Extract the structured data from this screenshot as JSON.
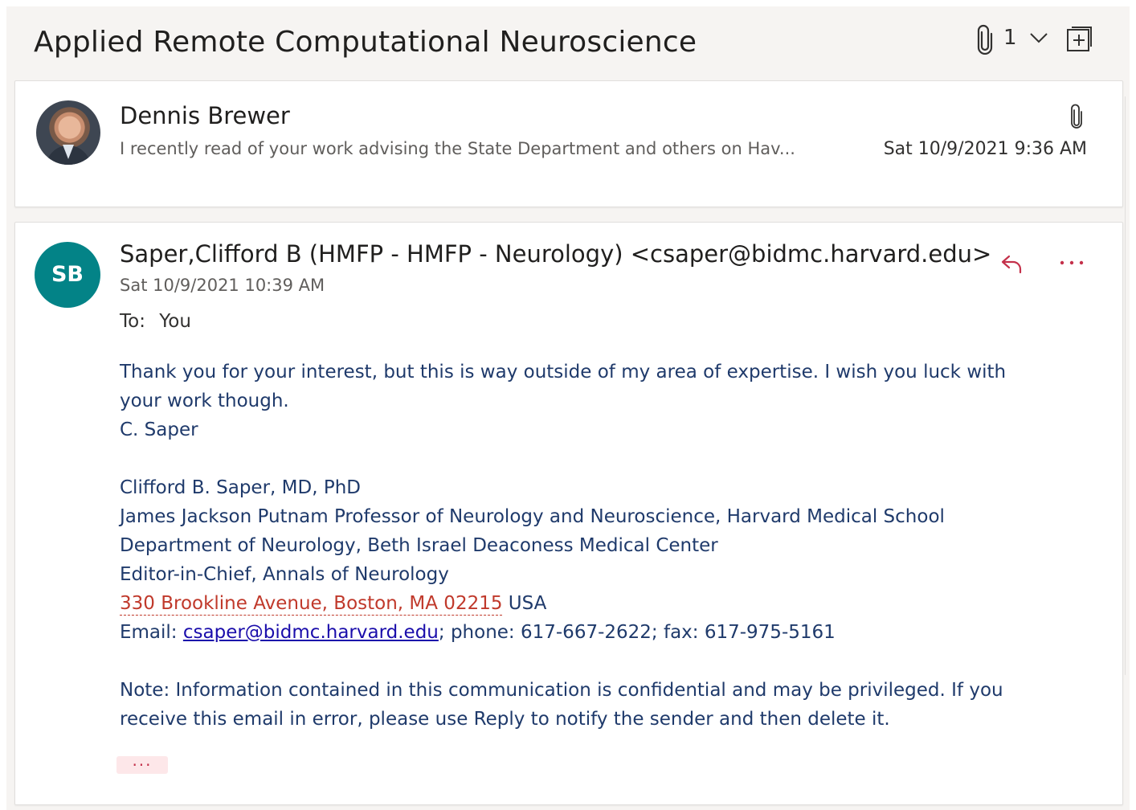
{
  "conversation": {
    "title": "Applied Remote Computational Neuroscience",
    "attachment_count": "1"
  },
  "message1": {
    "sender": "Dennis Brewer",
    "preview": "I recently read of your work advising the State Department and others on Hav...",
    "date": "Sat 10/9/2021 9:36 AM",
    "has_attachment": true
  },
  "message2": {
    "avatar_initials": "SB",
    "avatar_color": "#038387",
    "sender": "Saper,Clifford B (HMFP - HMFP - Neurology) <csaper@bidmc.harvard.edu>",
    "date": "Sat 10/9/2021 10:39 AM",
    "to_label": "To:",
    "to_value": "You",
    "body": {
      "line1": "Thank you for your interest, but this is way outside of my area of expertise.  I wish you luck with",
      "line2": "your work though.",
      "line3": "C. Saper",
      "sig_name": "Clifford B. Saper, MD, PhD",
      "sig_title": "James Jackson Putnam Professor of Neurology and Neuroscience, Harvard Medical School",
      "sig_dept": "Department of Neurology, Beth Israel Deaconess Medical Center",
      "sig_editor": "Editor-in-Chief, Annals of Neurology",
      "address": "330 Brookline Avenue, Boston, MA 02215",
      "country": " USA",
      "email_label": "Email: ",
      "email": "csaper@bidmc.harvard.edu",
      "phone_fax": "; phone: 617-667-2622; fax: 617-975-5161",
      "note1": "Note: Information contained in this communication is confidential and may be privileged. If you",
      "note2": "receive this email in error, please use Reply to notify the sender and then delete it."
    },
    "expand_label": "..."
  },
  "colors": {
    "reply_accent": "#c4314b",
    "body_text": "#1f3a6b",
    "address_red": "#c0392b",
    "link_blue": "#1a0dab"
  },
  "icons": [
    "paperclip-icon",
    "chevron-down-icon",
    "popout-icon",
    "reply-icon",
    "more-icon"
  ]
}
